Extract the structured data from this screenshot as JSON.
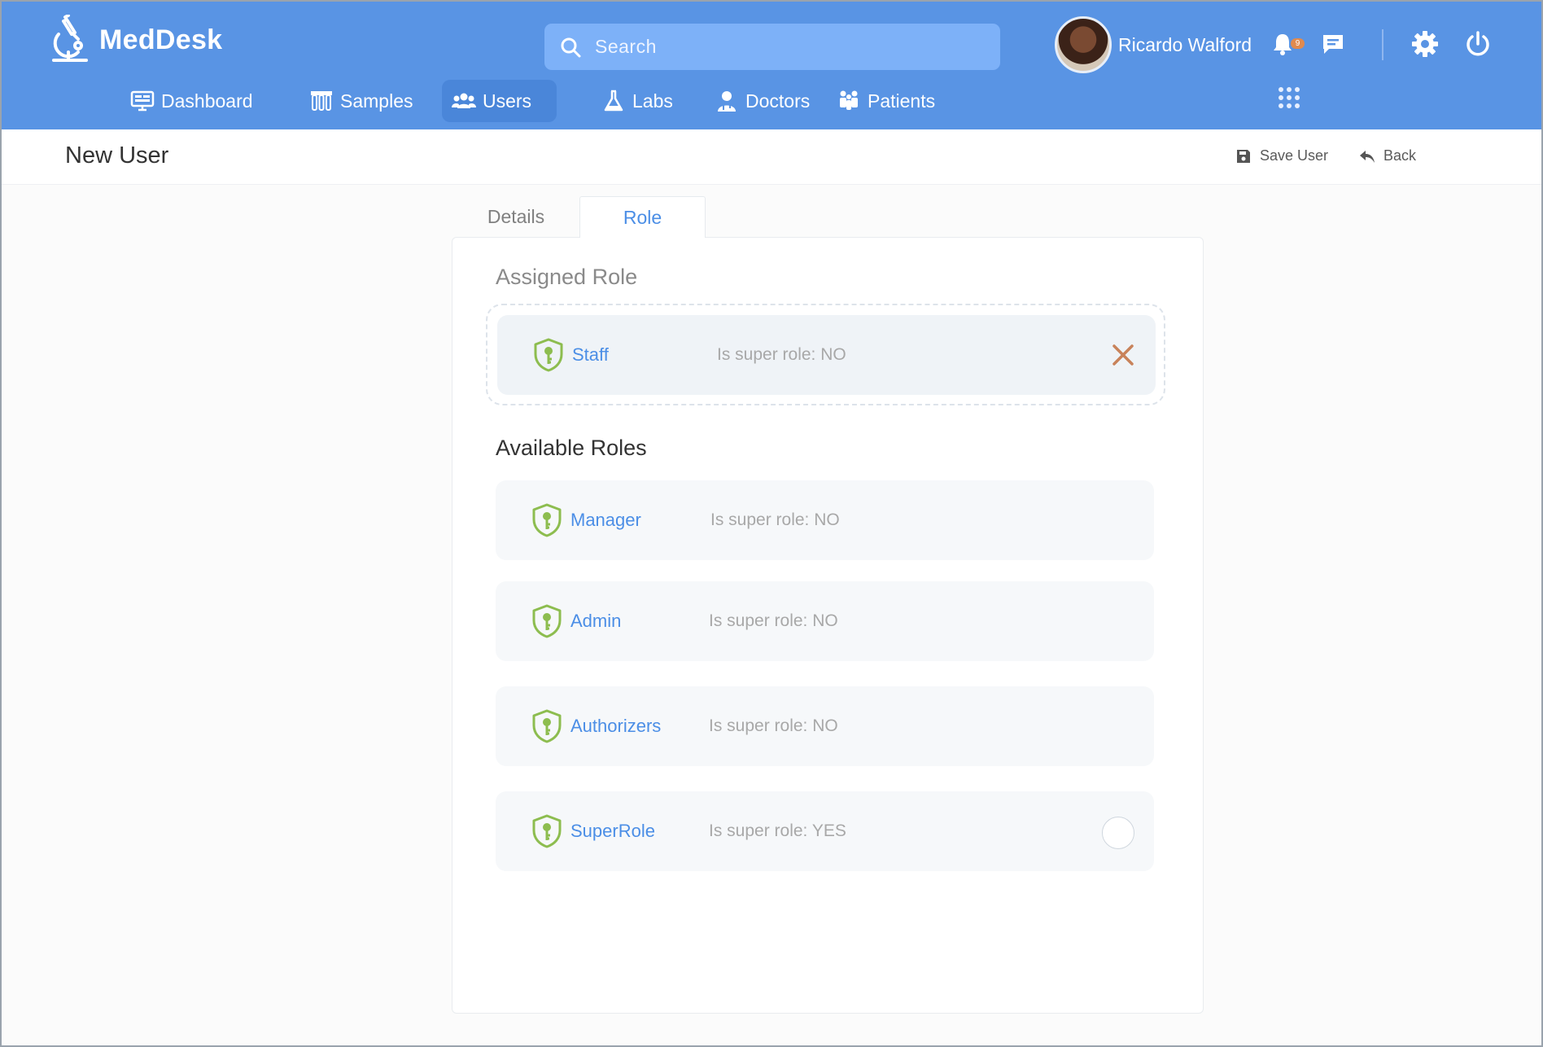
{
  "app": {
    "name": "MedDesk"
  },
  "search": {
    "placeholder": "Search"
  },
  "user": {
    "name": "Ricardo Walford",
    "notification_count": "9"
  },
  "nav": [
    {
      "label": "Dashboard",
      "icon": "monitor-icon"
    },
    {
      "label": "Samples",
      "icon": "test-tubes-icon"
    },
    {
      "label": "Users",
      "icon": "users-icon",
      "active": true
    },
    {
      "label": "Labs",
      "icon": "flask-icon"
    },
    {
      "label": "Doctors",
      "icon": "doctor-icon"
    },
    {
      "label": "Patients",
      "icon": "patients-icon"
    }
  ],
  "page": {
    "title": "New User",
    "actions": {
      "save": "Save User",
      "back": "Back"
    }
  },
  "tabs": {
    "details": "Details",
    "role": "Role",
    "active": "Role"
  },
  "assigned": {
    "title": "Assigned Role",
    "role": {
      "name": "Staff",
      "super": "Is super role: NO"
    }
  },
  "available": {
    "title": "Available Roles",
    "roles": [
      {
        "name": "Manager",
        "super": "Is super role: NO"
      },
      {
        "name": "Admin",
        "super": "Is super role: NO"
      },
      {
        "name": "Authorizers",
        "super": "Is super role: NO"
      },
      {
        "name": "SuperRole",
        "super": "Is super role: YES"
      }
    ]
  },
  "colors": {
    "header": "#5994e4",
    "accent": "#4b8ee6",
    "shield": "#8dbd4f",
    "remove": "#c8825a"
  }
}
